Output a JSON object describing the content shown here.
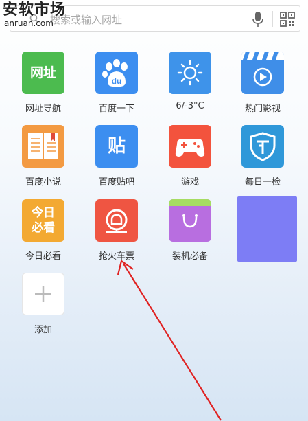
{
  "watermark": {
    "title": "安软市场",
    "url": "anruan.com"
  },
  "search": {
    "placeholder": "搜索或输入网址"
  },
  "apps": [
    {
      "label": "网址导航",
      "icon": "url-nav-icon",
      "tile_text": "网址",
      "color": "#4cbb4f"
    },
    {
      "label": "百度一下",
      "icon": "baidu-paw-icon",
      "tile_text": "du",
      "color": "#3c8ef0"
    },
    {
      "label": "6/-3°C",
      "icon": "sun-weather-icon",
      "color": "#3e93ea"
    },
    {
      "label": "热门影视",
      "icon": "video-clapper-icon",
      "color": "#3f8ee8"
    },
    {
      "label": "百度小说",
      "icon": "open-book-icon",
      "color": "#f39a42"
    },
    {
      "label": "百度贴吧",
      "icon": "tieba-icon",
      "tile_text": "贴",
      "color": "#3c8ef0"
    },
    {
      "label": "游戏",
      "icon": "gamepad-icon",
      "color": "#f3533d"
    },
    {
      "label": "每日一检",
      "icon": "shield-check-icon",
      "color": "#2f98d9"
    },
    {
      "label": "今日必看",
      "icon": "today-must-see-icon",
      "tile_text": "今日\n必看",
      "color": "#f3a932"
    },
    {
      "label": "抢火车票",
      "icon": "train-ticket-icon",
      "color": "#ef5542"
    },
    {
      "label": "装机必备",
      "icon": "shopping-bag-icon",
      "color": "#b86ee0"
    },
    {
      "label": "添加",
      "icon": "plus-icon",
      "color": "#ffffff"
    }
  ],
  "widget": {
    "color": "#7d7df5"
  },
  "annotation": {
    "color": "#e02222"
  }
}
